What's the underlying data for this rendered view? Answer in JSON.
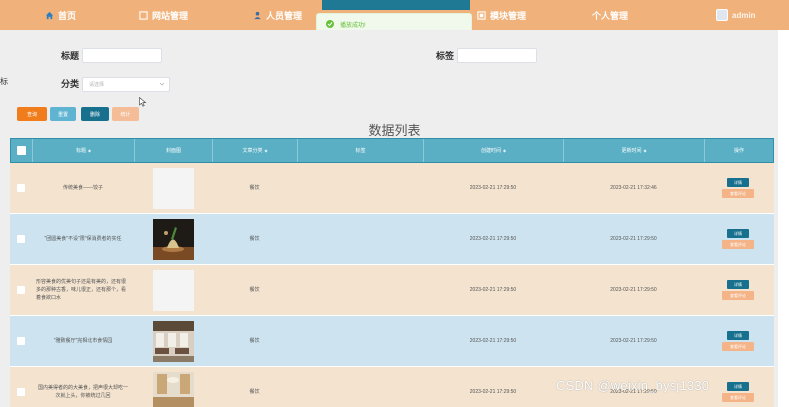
{
  "nav": {
    "home": "首页",
    "site": "网站管理",
    "people": "人员管理",
    "module": "模块管理",
    "personal": "个人管理",
    "admin": "admin"
  },
  "toast": {
    "text": "播放成功!"
  },
  "edge_char": "标",
  "form": {
    "title_label": "标题",
    "tag_label": "标签",
    "category_label": "分类",
    "category_placeholder": "请选择"
  },
  "buttons": {
    "query": "查询",
    "reset": "重置",
    "delete": "删除",
    "stats": "统计"
  },
  "list_title": "数据列表",
  "table": {
    "columns": [
      "标题",
      "封面图",
      "文章分类",
      "标签",
      "创建时间",
      "更新时间",
      "操作"
    ],
    "op_detail": "详情",
    "op_comment": "查看评论",
    "rows": [
      {
        "title": "传统美食——饺子",
        "category": "餐饮",
        "tag": "",
        "created": "2023-02-21 17:29:50",
        "updated": "2023-02-21 17:32:46",
        "image": "blank"
      },
      {
        "title": "\"团圆美食\"不设\"限\"保消费者的实任",
        "category": "餐饮",
        "tag": "",
        "created": "2023-02-21 17:29:50",
        "updated": "2023-02-21 17:29:50",
        "image": "dish"
      },
      {
        "title": "形容美食的优美句子还是有美的，还有很多的那种古香，味儿很正，还有那个，看着食欲口水",
        "category": "餐饮",
        "tag": "",
        "created": "2023-02-21 17:29:50",
        "updated": "2023-02-21 17:29:50",
        "image": "blank"
      },
      {
        "title": "\"雅致餐厅\"完相北市食情园",
        "category": "餐饮",
        "tag": "",
        "created": "2023-02-21 17:29:50",
        "updated": "2023-02-21 17:29:50",
        "image": "restaurant"
      },
      {
        "title": "国内美得者的的大美食，把声很大却吃一次就上头，你被统过几回",
        "category": "餐饮",
        "tag": "",
        "created": "2023-02-21 17:29:50",
        "updated": "2023-02-21 17:29:50",
        "image": "hall"
      }
    ]
  },
  "watermark": "CSDN @weixin_bysj1330",
  "colors": {
    "nav_bg": "#f0b27a",
    "header_bg": "#5aafc4",
    "row_even": "#f3e3cf",
    "row_odd": "#cde4f0",
    "query_btn": "#f07c1b",
    "delete_btn": "#17708e"
  }
}
